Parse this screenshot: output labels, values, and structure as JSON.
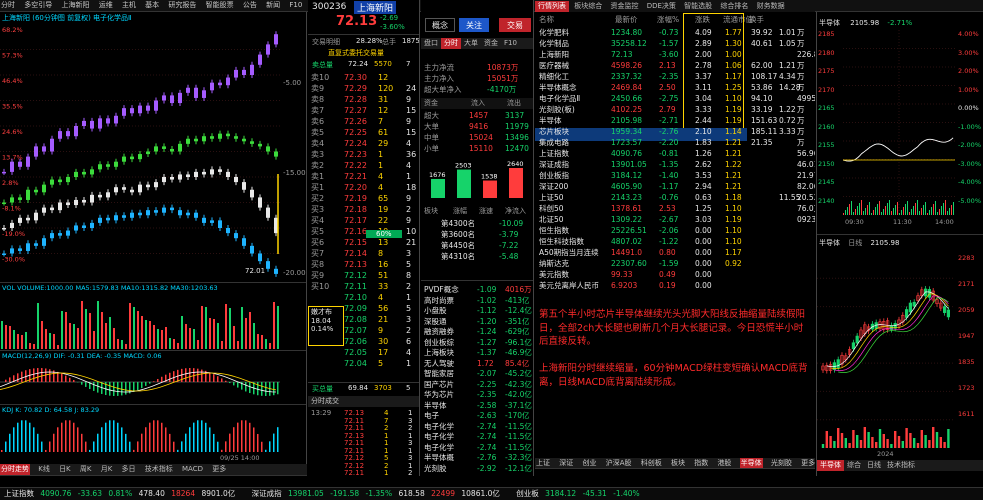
{
  "top_bar": {
    "left_items": [
      "分时",
      "多空引导",
      "上海新阳",
      "运维",
      "主机",
      "基本",
      "研究报告",
      "智能股票",
      "公告",
      "新闻",
      "F10"
    ],
    "stock_code": "300236",
    "stock_name": "上海新阳",
    "buttons": [
      "概念",
      "关注",
      "交易"
    ],
    "price": "72.13",
    "change": "-2.69",
    "change_pct": "-3.60%",
    "right_tabs": [
      "行情列表",
      "板块综合",
      "资金监控",
      "DDE决策",
      "智能选股",
      "综合排名",
      "财务数据",
      "公告信息",
      "多窗",
      "多层预测"
    ]
  },
  "left_chart": {
    "header": "上海新阳  (60分钟图 前复权)   电子化学品Ⅱ",
    "y_labels": [
      "68.2%",
      "57.3%",
      "46.4%",
      "35.5%",
      "24.6%",
      "13.7%",
      "2.8%",
      "-8.1%",
      "-19.0%",
      "-30.0%"
    ],
    "right_labels": [
      "-5.00",
      "-15.00",
      "-20.00"
    ],
    "last_price": "72.01",
    "vol_header": "VOL  VOLUME:1000.00  MA5:1579.83  MA10:1315.82  MA30:1203.63",
    "macd_header": "MACD(12,26,9)  DIF: -0.31  DEA: -0.35  MACD: 0.06",
    "kdj_header": "KDJ  K: 70.82  D: 64.58  J: 83.29",
    "bottom_tabs": [
      "分时走势",
      "K线",
      "日K",
      "周K",
      "月K",
      "多日",
      "技术指标",
      "MACD",
      "更多"
    ],
    "date_label": "09/25 14:00"
  },
  "chart_data": {
    "type": "line",
    "title": "上海新阳 60分钟",
    "series": [
      {
        "name": "purple",
        "values": [
          42,
          46,
          44,
          48,
          52,
          50,
          55,
          58,
          56,
          60,
          62,
          59,
          63,
          61,
          64,
          67,
          65,
          68,
          66,
          70,
          72,
          69,
          73,
          75,
          71,
          74,
          77,
          76,
          79,
          82,
          80,
          84,
          88,
          92,
          96
        ]
      },
      {
        "name": "green",
        "values": [
          30,
          32,
          31,
          35,
          34,
          37,
          39,
          38,
          40,
          42,
          41,
          43,
          45,
          44,
          46,
          48,
          47,
          49,
          50,
          52,
          51,
          50,
          53,
          55,
          54,
          56,
          55,
          57,
          56,
          55,
          54,
          53,
          52,
          50,
          48
        ]
      },
      {
        "name": "white",
        "values": [
          20,
          22,
          24,
          23,
          26,
          28,
          27,
          30,
          29,
          31,
          30,
          33,
          32,
          34,
          36,
          35,
          34,
          37,
          36,
          38,
          40,
          39,
          41,
          40,
          42,
          41,
          43,
          42,
          40,
          38,
          35,
          32,
          28,
          24,
          18
        ]
      },
      {
        "name": "blue",
        "values": [
          10,
          12,
          11,
          14,
          13,
          16,
          18,
          17,
          19,
          21,
          20,
          22,
          24,
          23,
          25,
          24,
          26,
          25,
          27,
          26,
          28,
          27,
          25,
          26,
          24,
          22,
          23,
          20,
          18,
          16,
          13,
          10,
          7,
          4,
          2
        ]
      }
    ]
  },
  "order_book": {
    "header": [
      "交易明细",
      "28.28%",
      "总手",
      "1875"
    ],
    "title": "直复式委托交易量",
    "summary": [
      "卖总量",
      "72.24",
      "5570",
      "7"
    ],
    "rows": [
      [
        "卖10",
        "72.30",
        "12",
        ""
      ],
      [
        "卖9",
        "72.29",
        "120",
        "24"
      ],
      [
        "卖8",
        "72.28",
        "31",
        "9"
      ],
      [
        "卖7",
        "72.27",
        "12",
        "15"
      ],
      [
        "卖6",
        "72.26",
        "7",
        "9"
      ],
      [
        "卖5",
        "72.25",
        "61",
        "15"
      ],
      [
        "卖4",
        "72.24",
        "29",
        "4"
      ],
      [
        "卖3",
        "72.23",
        "1",
        "36"
      ],
      [
        "卖2",
        "72.22",
        "1",
        "4"
      ],
      [
        "卖1",
        "72.21",
        "4",
        "1"
      ],
      [
        "买1",
        "72.20",
        "4",
        "18"
      ],
      [
        "买2",
        "72.19",
        "65",
        "9"
      ],
      [
        "买3",
        "72.18",
        "19",
        "2"
      ],
      [
        "买4",
        "72.17",
        "22",
        "9"
      ],
      [
        "买5",
        "72.16",
        "10",
        "10"
      ],
      [
        "买6",
        "72.15",
        "13",
        "21"
      ],
      [
        "买7",
        "72.14",
        "8",
        "3"
      ],
      [
        "买8",
        "72.13",
        "16",
        "5"
      ],
      [
        "买9",
        "72.12",
        "51",
        "8"
      ],
      [
        "买10",
        "72.11",
        "33",
        "2"
      ],
      [
        "",
        "72.10",
        "4",
        "1"
      ],
      [
        "",
        "72.09",
        "56",
        "5"
      ],
      [
        "",
        "72.08",
        "21",
        "3"
      ],
      [
        "",
        "72.07",
        "9",
        "2"
      ],
      [
        "",
        "72.06",
        "30",
        "6"
      ],
      [
        "",
        "72.05",
        "17",
        "4"
      ],
      [
        "",
        "72.04",
        "5",
        "1"
      ]
    ],
    "mid_label": "60%",
    "highlight_text": [
      "嫩才布",
      "18.04",
      "0.14%"
    ],
    "footer": [
      "买总量",
      "69.84",
      "3703",
      "5"
    ],
    "ticks_header": "分时成交",
    "ticks": [
      [
        "13:29",
        "72.13",
        "4",
        "1"
      ],
      [
        "",
        "72.11",
        "7",
        "3"
      ],
      [
        "",
        "72.11",
        "2",
        "2"
      ],
      [
        "",
        "72.13",
        "1",
        "1"
      ],
      [
        "",
        "72.11",
        "1",
        "3"
      ],
      [
        "",
        "72.11",
        "1",
        "1"
      ],
      [
        "",
        "72.12",
        "5",
        "3"
      ],
      [
        "",
        "72.12",
        "2",
        "1"
      ],
      [
        "",
        "72.11",
        "1",
        "2"
      ]
    ]
  },
  "quote_panel": {
    "tabs": [
      "盘口",
      "分时",
      "大单",
      "资金",
      "F10"
    ],
    "fields": [
      [
        "主力净流",
        "10873万"
      ],
      [
        "主力净入",
        "15051万"
      ],
      [
        "超大单净入",
        "-4170万"
      ]
    ],
    "flow_headers": [
      "资金",
      "流入",
      "流出"
    ],
    "flow_rows": [
      [
        "超大",
        "1457",
        "3137"
      ],
      [
        "大单",
        "9416",
        "11979"
      ],
      [
        "中单",
        "15024",
        "13496"
      ],
      [
        "小单",
        "15110",
        "12470"
      ]
    ],
    "bars": [
      {
        "label": "1676",
        "value": 1676,
        "color": "#16d36a"
      },
      {
        "label": "2503",
        "value": 2503,
        "color": "#16d36a"
      },
      {
        "label": "1538",
        "value": 1538,
        "color": "#ff3c3c"
      },
      {
        "label": "2640",
        "value": 2640,
        "color": "#ff3c3c"
      }
    ],
    "rank_header": [
      "板块",
      "涨幅",
      "涨速",
      "净流入"
    ],
    "rank_rows": [
      [
        "第4300名",
        "-10.09"
      ],
      [
        "第3600名",
        "-3.79"
      ],
      [
        "第4450名",
        "-7.22"
      ],
      [
        "第4310名",
        "-5.48"
      ]
    ],
    "sector_rows": [
      [
        "PVDF概念",
        "-1.09",
        "4016万"
      ],
      [
        "高时尚票",
        "-1.02",
        "-413亿"
      ],
      [
        "小盘股",
        "-1.12",
        "-12.4亿"
      ],
      [
        "深股通",
        "-1.20",
        "-351亿"
      ],
      [
        "融资融券",
        "-1.24",
        "-629亿"
      ],
      [
        "创业板综",
        "-1.27",
        "-96.1亿"
      ],
      [
        "上海板块",
        "-1.37",
        "-46.9亿"
      ],
      [
        "无人驾驶",
        "1.72",
        "85.4亿"
      ],
      [
        "智能家居",
        "-2.07",
        "-45.2亿"
      ],
      [
        "国产芯片",
        "-2.25",
        "-42.3亿"
      ],
      [
        "华为芯片",
        "-2.35",
        "-42.0亿"
      ],
      [
        "半导体",
        "-2.58",
        "-37.1亿"
      ],
      [
        "电子",
        "-2.63",
        "-170亿"
      ],
      [
        "电子化学",
        "-2.74",
        "-11.5亿"
      ],
      [
        "电子化学",
        "-2.74",
        "-11.5亿"
      ],
      [
        "电子化学",
        "-2.74",
        "-11.5亿"
      ],
      [
        "半导体概",
        "-2.76",
        "-32.3亿"
      ],
      [
        "光刻胶",
        "-2.92",
        "-12.1亿"
      ]
    ]
  },
  "market_table": {
    "headers": [
      "名称",
      "最新价",
      "涨幅%",
      "涨跌",
      "流通市值",
      "换手"
    ],
    "rows": [
      [
        "化学肥料",
        "1234.80",
        "-0.73",
        "4.09",
        "1.77"
      ],
      [
        "化学制品",
        "35258.12",
        "-1.57",
        "2.89",
        "1.30"
      ],
      [
        "上海新阳",
        "72.13",
        "-3.60",
        "2.00",
        "1.00"
      ],
      [
        "医疗器械",
        "4598.26",
        "2.13",
        "2.78",
        "1.06"
      ],
      [
        "精细化工",
        "2337.32",
        "-2.35",
        "3.37",
        "1.17"
      ],
      [
        "半导体概念",
        "2469.84",
        "2.50",
        "3.11",
        "1.25"
      ],
      [
        "电子化学品Ⅱ",
        "2450.66",
        "-2.75",
        "3.04",
        "1.10"
      ],
      [
        "光刻胶(板)",
        "4102.25",
        "2.79",
        "3.33",
        "1.19"
      ],
      [
        "半导体",
        "2105.98",
        "-2.71",
        "2.44",
        "1.19"
      ],
      [
        "芯片板块",
        "1959.34",
        "-2.76",
        "2.10",
        "1.14"
      ],
      [
        "集成电路",
        "1723.57",
        "-2.20",
        "1.83",
        "1.21"
      ],
      [
        "上证指数",
        "4090.76",
        "-0.81",
        "1.26",
        "1.21"
      ],
      [
        "深证成指",
        "13901.05",
        "-1.35",
        "2.62",
        "1.22"
      ],
      [
        "创业板指",
        "3184.12",
        "-1.40",
        "3.53",
        "1.21"
      ],
      [
        "深证200",
        "4605.90",
        "-1.17",
        "2.94",
        "1.21"
      ],
      [
        "上证50",
        "2143.23",
        "-0.76",
        "0.63",
        "1.18"
      ],
      [
        "科创50",
        "1378.61",
        "2.53",
        "1.25",
        "1.10"
      ],
      [
        "北证50",
        "1309.22",
        "-2.67",
        "3.03",
        "1.19"
      ],
      [
        "恒生指数",
        "25226.51",
        "-2.06",
        "0.00",
        "1.10"
      ],
      [
        "恒生科技指数",
        "4807.02",
        "-1.22",
        "0.00",
        "1.10"
      ],
      [
        "A50期指当月连续",
        "14491.0",
        "0.80",
        "0.00",
        "1.17"
      ],
      [
        "纳斯达克",
        "22307.60",
        "-1.59",
        "0.00",
        "0.92"
      ],
      [
        "美元指数",
        "99.33",
        "0.49",
        "0.00",
        ""
      ],
      [
        "美元兑离岸人民币",
        "6.9203",
        "0.19",
        "0.00",
        ""
      ]
    ],
    "extra_headers": [
      "市盈率",
      "量比",
      "总市值"
    ],
    "extra_rows": [
      [
        "39.92",
        "1.01",
        "万"
      ],
      [
        "40.61",
        "1.05",
        "万"
      ],
      [
        "",
        "",
        "226.8"
      ],
      [
        "62.00",
        "1.21",
        "万"
      ],
      [
        "108.17",
        "4.34",
        "万"
      ],
      [
        "53.86",
        "14.28",
        "万"
      ],
      [
        "94.10",
        "",
        "4995"
      ],
      [
        "33.19",
        "1.22",
        "万"
      ],
      [
        "151.63",
        "0.72",
        "万"
      ],
      [
        "185.11",
        "3.33",
        "万"
      ],
      [
        "21.35",
        "",
        "万"
      ],
      [
        "",
        "",
        "56.96万"
      ],
      [
        "",
        "",
        "46.01万"
      ],
      [
        "",
        "",
        "21.97万"
      ],
      [
        "",
        "",
        "82.06万"
      ],
      [
        "",
        "11.55",
        "20.52万"
      ],
      [
        "",
        "",
        "76.0万"
      ],
      [
        "",
        "",
        "0923"
      ]
    ],
    "bottom_tabs": [
      "上证",
      "深证",
      "创业",
      "中小板",
      "沪深A股",
      "新",
      "科创板",
      "板块",
      "指数",
      "港股",
      "美股",
      "期货",
      "基金",
      "债券",
      "行业",
      "概念",
      "地域",
      "半导体",
      "光刻胶",
      "东方财富",
      "更多"
    ]
  },
  "news": {
    "paragraph1": "第五个半小时芯片半导体继续光头光脚大阳线反抽缩量陆续假阳日，全部2ch大长腿也刷新几个月大长腿记录。今日恐慌半小时后直接反转。",
    "paragraph2": "上海新阳分时继续缩量，60分钟MACD绿柱变短确认MACD底背离，日线MACD底背离陆续形成。"
  },
  "right_panel": {
    "top_title": "半导体",
    "top_value": "2105.98",
    "top_change": "-2.71%",
    "top_y_labels": [
      "4.00%",
      "3.00%",
      "2.00%",
      "1.00%",
      "0.00%",
      "-1.00%",
      "-2.00%",
      "-3.00%",
      "-4.00%",
      "-5.00%"
    ],
    "top_left_labels": [
      "2185",
      "2180",
      "2175",
      "2170",
      "2165",
      "2160",
      "2155",
      "2150",
      "2145",
      "2140"
    ],
    "time_labels": [
      "09:30",
      "11:30",
      "14:00"
    ],
    "mid_tabs": [
      "半导体",
      "日线",
      "2105.98"
    ],
    "bottom_y_labels": [
      "2283",
      "2171",
      "2059",
      "1947",
      "1835",
      "1723",
      "1611"
    ],
    "bottom_date": "2024",
    "bottom_tabs": [
      "半导体",
      "综合",
      "日线",
      "技术指标"
    ]
  },
  "status_bar": {
    "items": [
      "上证指数",
      "4090.76",
      "-33.63",
      "0.81%",
      "478.40",
      "18264",
      "8901.0亿",
      "深证成指",
      "13981.05",
      "-191.58",
      "-1.35%",
      "618.58",
      "22499",
      "10861.0亿",
      "创业板",
      "3184.12",
      "-45.31",
      "-1.40%"
    ]
  },
  "colors": {
    "up": "#ff3c3c",
    "down": "#16d36a",
    "accent": "#c0242b",
    "highlight": "#ffd400"
  }
}
